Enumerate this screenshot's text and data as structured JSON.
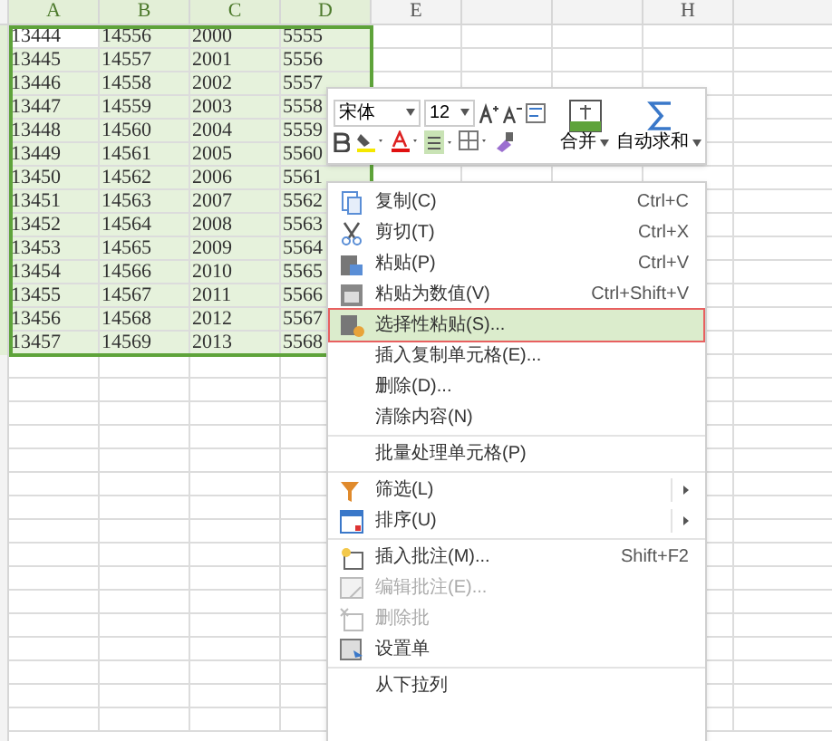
{
  "sheet": {
    "columns": [
      {
        "label": "A"
      },
      {
        "label": "B"
      },
      {
        "label": "C"
      },
      {
        "label": "D"
      },
      {
        "label": "E"
      },
      {},
      {},
      {
        "label": "H"
      }
    ],
    "rows": [
      [
        "13444",
        "14556",
        "2000",
        "5555"
      ],
      [
        "13445",
        "14557",
        "2001",
        "5556"
      ],
      [
        "13446",
        "14558",
        "2002",
        "5557"
      ],
      [
        "13447",
        "14559",
        "2003",
        "5558"
      ],
      [
        "13448",
        "14560",
        "2004",
        "5559"
      ],
      [
        "13449",
        "14561",
        "2005",
        "5560"
      ],
      [
        "13450",
        "14562",
        "2006",
        "5561"
      ],
      [
        "13451",
        "14563",
        "2007",
        "5562"
      ],
      [
        "13452",
        "14564",
        "2008",
        "5563"
      ],
      [
        "13453",
        "14565",
        "2009",
        "5564"
      ],
      [
        "13454",
        "14566",
        "2010",
        "5565"
      ],
      [
        "13455",
        "14567",
        "2011",
        "5566"
      ],
      [
        "13456",
        "14568",
        "2012",
        "5567"
      ],
      [
        "13457",
        "14569",
        "2013",
        "5568"
      ]
    ]
  },
  "mini_toolbar": {
    "font": "宋体",
    "size": "12",
    "merge": "合并",
    "autosum": "自动求和"
  },
  "menu": {
    "groups": [
      [
        {
          "kind": "copy",
          "label": "复制(C)",
          "shortcut": "Ctrl+C",
          "selected": false,
          "disabled": false
        },
        {
          "kind": "cut",
          "label": "剪切(T)",
          "shortcut": "Ctrl+X",
          "selected": false,
          "disabled": false
        },
        {
          "kind": "paste",
          "label": "粘贴(P)",
          "shortcut": "Ctrl+V",
          "selected": false,
          "disabled": false
        },
        {
          "kind": "paste-values",
          "label": "粘贴为数值(V)",
          "shortcut": "Ctrl+Shift+V",
          "selected": false,
          "disabled": false
        },
        {
          "kind": "paste-special",
          "label": "选择性粘贴(S)...",
          "selected": true,
          "disabled": false
        },
        {
          "label": "插入复制单元格(E)...",
          "selected": false,
          "disabled": false
        },
        {
          "label": "删除(D)...",
          "selected": false,
          "disabled": false
        },
        {
          "label": "清除内容(N)",
          "selected": false,
          "disabled": false
        }
      ],
      [
        {
          "label": "批量处理单元格(P)",
          "selected": false,
          "disabled": false
        }
      ],
      [
        {
          "kind": "filter",
          "label": "筛选(L)",
          "submenu": true,
          "selected": false,
          "disabled": false
        },
        {
          "kind": "sort",
          "label": "排序(U)",
          "submenu": true,
          "selected": false,
          "disabled": false
        }
      ],
      [
        {
          "kind": "note-add",
          "label": "插入批注(M)...",
          "shortcut": "Shift+F2",
          "selected": false,
          "disabled": false
        },
        {
          "kind": "note-edit",
          "label": "编辑批注(E)...",
          "selected": false,
          "disabled": true
        },
        {
          "kind": "note-delete",
          "label": "删除批",
          "selected": false,
          "disabled": true
        },
        {
          "kind": "format",
          "label": "设置单",
          "selected": false,
          "disabled": false
        }
      ],
      [
        {
          "label": "从下拉列",
          "selected": false,
          "disabled": false
        }
      ]
    ]
  }
}
